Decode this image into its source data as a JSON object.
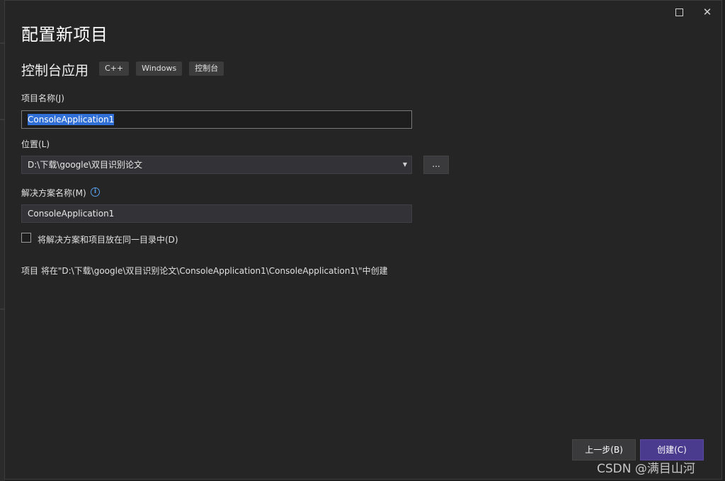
{
  "window": {
    "maximize_label": "",
    "close_label": "✕"
  },
  "header": {
    "title": "配置新项目",
    "template_name": "控制台应用",
    "tags": [
      "C++",
      "Windows",
      "控制台"
    ]
  },
  "form": {
    "project_name_label": "项目名称(J)",
    "project_name_value": "ConsoleApplication1",
    "location_label": "位置(L)",
    "location_value": "D:\\下载\\google\\双目识别论文",
    "browse_label": "...",
    "solution_name_label": "解决方案名称(M)",
    "solution_name_value": "ConsoleApplication1",
    "same_dir_label": "将解决方案和项目放在同一目录中(D)",
    "same_dir_checked": false,
    "path_summary": "项目 将在\"D:\\下载\\google\\双目识别论文\\ConsoleApplication1\\ConsoleApplication1\\\"中创建"
  },
  "footer": {
    "back_label": "上一步(B)",
    "create_label": "创建(C)"
  },
  "watermark": "CSDN @满目山河",
  "colors": {
    "accent": "#4b3b8f",
    "selection": "#2f6fd6",
    "info": "#5aa0e6"
  }
}
